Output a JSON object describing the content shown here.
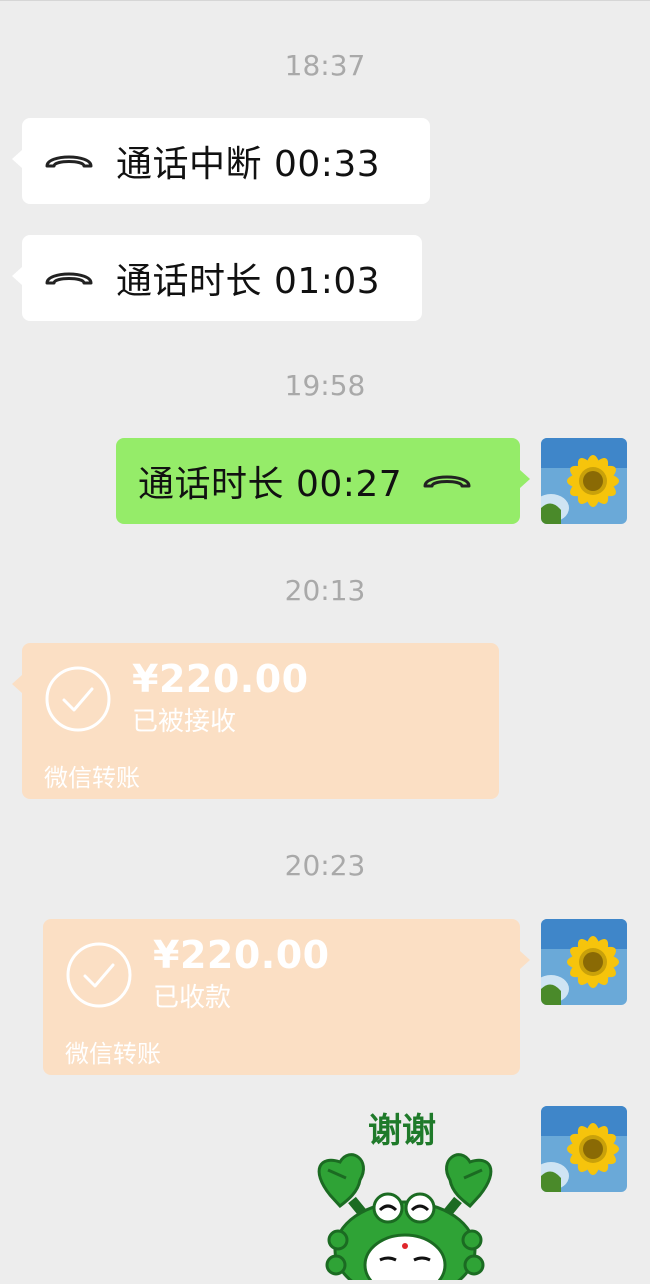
{
  "messages": {
    "ts1": "18:37",
    "call1": "通话中断 00:33",
    "call2": "通话时长 01:03",
    "ts2": "19:58",
    "call3": "通话时长 00:27",
    "ts3": "20:13",
    "transfer1": {
      "amount": "¥220.00",
      "status": "已被接收",
      "footer": "微信转账"
    },
    "ts4": "20:23",
    "transfer2": {
      "amount": "¥220.00",
      "status": "已收款",
      "footer": "微信转账"
    },
    "sticker_text": "谢谢"
  },
  "colors": {
    "background": "#ededed",
    "green_bubble": "#95ec69",
    "transfer_bubble": "#fbdfc4",
    "timestamp": "#a9a9a9"
  },
  "icons": [
    "phone-hangup-icon",
    "check-circle-icon",
    "sunflower-avatar",
    "crab-sticker"
  ]
}
